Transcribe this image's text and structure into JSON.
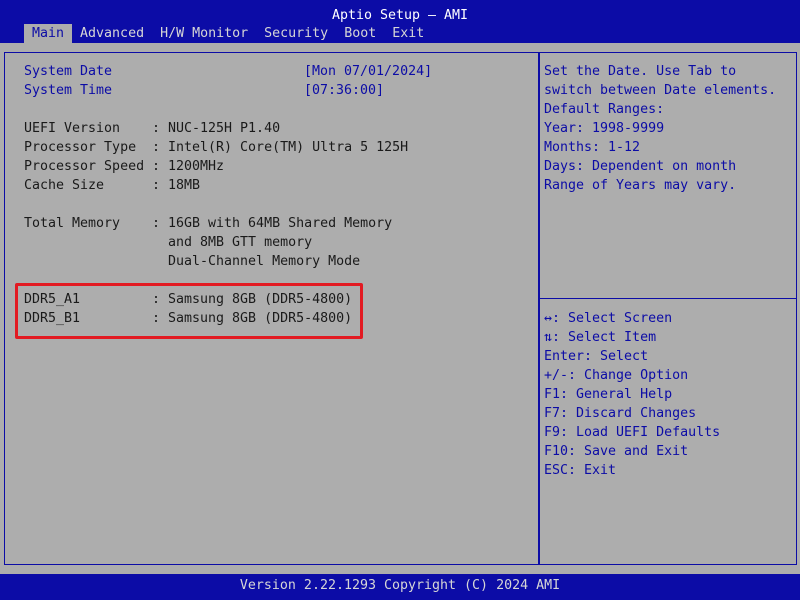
{
  "app_title": "Aptio Setup – AMI",
  "tabs": [
    "Main",
    "Advanced",
    "H/W Monitor",
    "Security",
    "Boot",
    "Exit"
  ],
  "date_time": {
    "system_date_label": "System Date",
    "system_date_value": "[Mon 07/01/2024]",
    "system_time_label": "System Time",
    "system_time_value": "[07:36:00]"
  },
  "info": {
    "separator": ":",
    "uefi_version_label": "UEFI Version",
    "uefi_version_value": "NUC-125H P1.40",
    "processor_type_label": "Processor Type",
    "processor_type_value": "Intel(R) Core(TM) Ultra 5 125H",
    "processor_speed_label": "Processor Speed",
    "processor_speed_value": "1200MHz",
    "cache_size_label": "Cache Size",
    "cache_size_value": "18MB",
    "total_memory_label": "Total Memory",
    "total_memory_line1": "16GB with 64MB Shared Memory",
    "total_memory_line2": "and 8MB GTT memory",
    "total_memory_line3": "Dual-Channel Memory Mode",
    "ddr5_a1_label": "DDR5_A1",
    "ddr5_a1_value": "Samsung 8GB (DDR5-4800)",
    "ddr5_b1_label": "DDR5_B1",
    "ddr5_b1_value": "Samsung 8GB (DDR5-4800)"
  },
  "help": {
    "description": [
      "Set the Date. Use Tab to",
      "switch between Date elements.",
      "Default Ranges:",
      "Year: 1998-9999",
      "Months: 1-12",
      "Days: Dependent on month",
      "Range of Years may vary."
    ],
    "keys": [
      "↔: Select Screen",
      "⇅: Select Item",
      "Enter: Select",
      "+/-: Change Option",
      "F1: General Help",
      "F7: Discard Changes",
      "F9: Load UEFI Defaults",
      "F10: Save and Exit",
      "ESC: Exit"
    ]
  },
  "footer": "Version 2.22.1293 Copyright (C) 2024 AMI",
  "colors": {
    "background": "#adadad",
    "title_bar": "#0c0ca6",
    "text_blue": "#0c0ca6",
    "highlight_border": "#e21a22"
  }
}
